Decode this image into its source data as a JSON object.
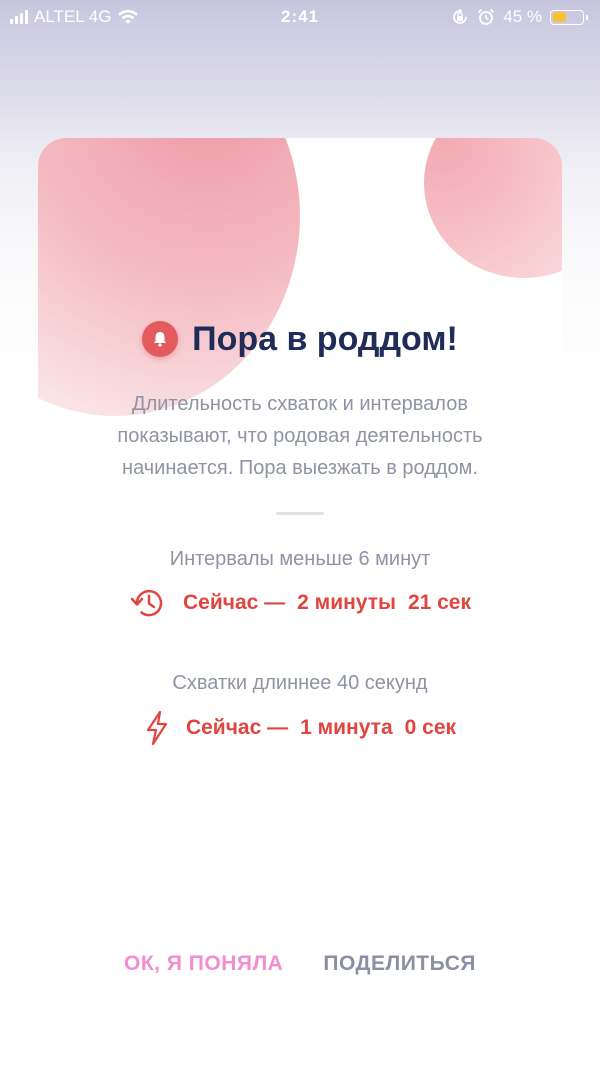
{
  "status_bar": {
    "carrier": "ALTEL 4G",
    "time": "2:41",
    "battery_percent": "45 %",
    "battery_level": 0.45
  },
  "card": {
    "title": "Пора в роддом!",
    "title_icon": "bell-icon",
    "description_lines": [
      "Длительность схваток и интервалов",
      "показывают, что родовая деятельность",
      "начинается. Пора выезжать в роддом."
    ],
    "criteria": [
      {
        "label": "Интервалы меньше 6 минут",
        "icon": "clock-history-icon",
        "now_label": "Сейчас —",
        "value_main": "2 минуты",
        "value_secondary": "21 сек"
      },
      {
        "label": "Схватки длиннее 40 секунд",
        "icon": "lightning-icon",
        "now_label": "Сейчас —",
        "value_main": "1 минута",
        "value_secondary": "0 сек"
      }
    ]
  },
  "actions": {
    "ok_label": "ОК, Я ПОНЯЛА",
    "share_label": "ПОДЕЛИТЬСЯ"
  },
  "colors": {
    "accent_red": "#e2443f",
    "title_navy": "#1f2c58",
    "ok_pink": "#f28ed0",
    "muted_gray": "#8f93a4"
  }
}
